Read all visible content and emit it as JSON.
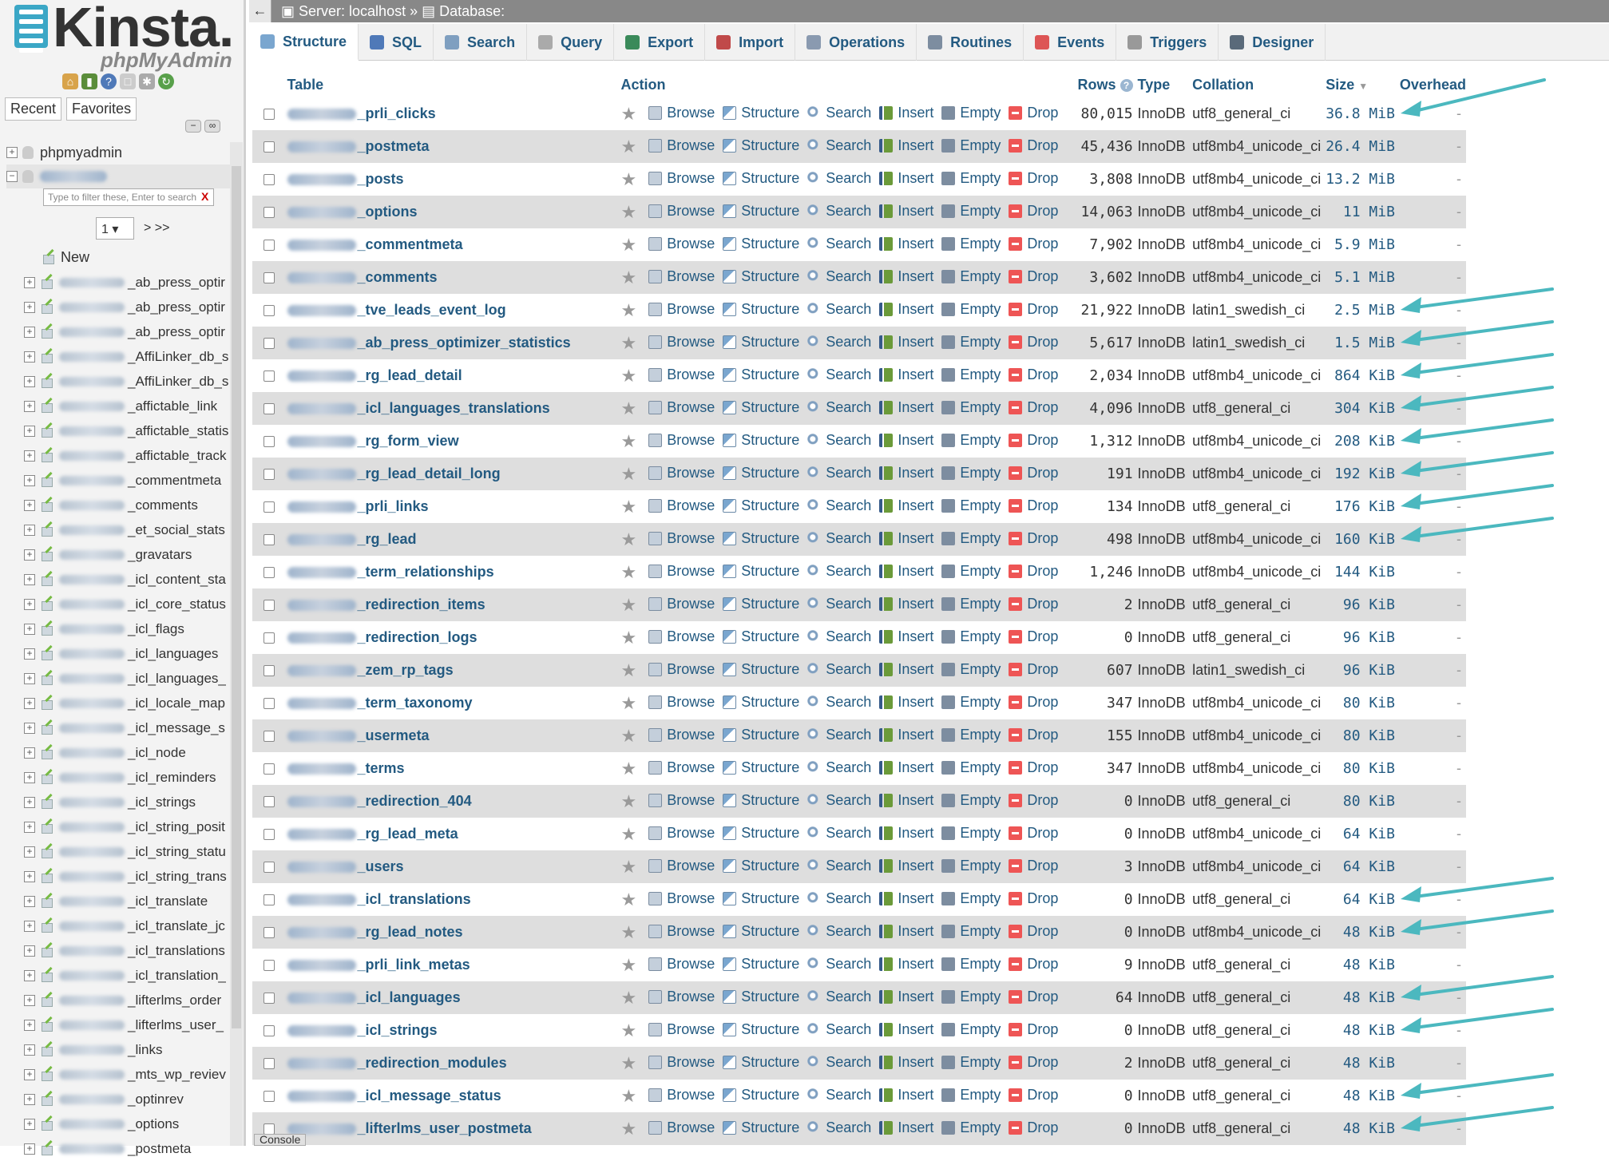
{
  "logo": {
    "brand": "Kinsta.",
    "product": "phpMyAdmin"
  },
  "nav": {
    "tab_recent": "Recent",
    "tab_favorites": "Favorites",
    "root_db": "phpmyadmin",
    "filter_placeholder": "Type to filter these, Enter to search",
    "filter_clear": "X",
    "page_value": "1",
    "page_next": "> >>",
    "new_label": "New",
    "items": [
      "_ab_press_optir",
      "_ab_press_optir",
      "_ab_press_optir",
      "_AffiLinker_db_s",
      "_AffiLinker_db_s",
      "_affictable_link",
      "_affictable_statis",
      "_affictable_track",
      "_commentmeta",
      "_comments",
      "_et_social_stats",
      "_gravatars",
      "_icl_content_sta",
      "_icl_core_status",
      "_icl_flags",
      "_icl_languages",
      "_icl_languages_",
      "_icl_locale_map",
      "_icl_message_s",
      "_icl_node",
      "_icl_reminders",
      "_icl_strings",
      "_icl_string_posit",
      "_icl_string_statu",
      "_icl_string_trans",
      "_icl_translate",
      "_icl_translate_jc",
      "_icl_translations",
      "_icl_translation_",
      "_lifterlms_order",
      "_lifterlms_user_",
      "_links",
      "_mts_wp_reviev",
      "_optinrev",
      "_options",
      "_postmeta"
    ]
  },
  "topbar": {
    "back": "←",
    "server": "Server: localhost »",
    "database": "Database:"
  },
  "tabs": [
    "Structure",
    "SQL",
    "Search",
    "Query",
    "Export",
    "Import",
    "Operations",
    "Routines",
    "Events",
    "Triggers",
    "Designer"
  ],
  "columns": {
    "table": "Table",
    "action": "Action",
    "rows": "Rows",
    "rows_help": "?",
    "type": "Type",
    "collation": "Collation",
    "size": "Size",
    "size_sort": "▼",
    "overhead": "Overhead"
  },
  "actions": {
    "browse": "Browse",
    "structure": "Structure",
    "search": "Search",
    "insert": "Insert",
    "empty": "Empty",
    "drop": "Drop"
  },
  "console": "Console",
  "rows": [
    {
      "name": "_prli_clicks",
      "rows": "80,015",
      "type": "InnoDB",
      "collation": "utf8_general_ci",
      "size": "36.8 MiB",
      "overhead": "-"
    },
    {
      "name": "_postmeta",
      "rows": "45,436",
      "type": "InnoDB",
      "collation": "utf8mb4_unicode_ci",
      "size": "26.4 MiB",
      "overhead": "-"
    },
    {
      "name": "_posts",
      "rows": "3,808",
      "type": "InnoDB",
      "collation": "utf8mb4_unicode_ci",
      "size": "13.2 MiB",
      "overhead": "-"
    },
    {
      "name": "_options",
      "rows": "14,063",
      "type": "InnoDB",
      "collation": "utf8mb4_unicode_ci",
      "size": "11 MiB",
      "overhead": "-"
    },
    {
      "name": "_commentmeta",
      "rows": "7,902",
      "type": "InnoDB",
      "collation": "utf8mb4_unicode_ci",
      "size": "5.9 MiB",
      "overhead": "-"
    },
    {
      "name": "_comments",
      "rows": "3,602",
      "type": "InnoDB",
      "collation": "utf8mb4_unicode_ci",
      "size": "5.1 MiB",
      "overhead": "-"
    },
    {
      "name": "_tve_leads_event_log",
      "rows": "21,922",
      "type": "InnoDB",
      "collation": "latin1_swedish_ci",
      "size": "2.5 MiB",
      "overhead": "-"
    },
    {
      "name": "_ab_press_optimizer_statistics",
      "rows": "5,617",
      "type": "InnoDB",
      "collation": "latin1_swedish_ci",
      "size": "1.5 MiB",
      "overhead": "-"
    },
    {
      "name": "_rg_lead_detail",
      "rows": "2,034",
      "type": "InnoDB",
      "collation": "utf8mb4_unicode_ci",
      "size": "864 KiB",
      "overhead": "-"
    },
    {
      "name": "_icl_languages_translations",
      "rows": "4,096",
      "type": "InnoDB",
      "collation": "utf8_general_ci",
      "size": "304 KiB",
      "overhead": "-"
    },
    {
      "name": "_rg_form_view",
      "rows": "1,312",
      "type": "InnoDB",
      "collation": "utf8mb4_unicode_ci",
      "size": "208 KiB",
      "overhead": "-"
    },
    {
      "name": "_rg_lead_detail_long",
      "rows": "191",
      "type": "InnoDB",
      "collation": "utf8mb4_unicode_ci",
      "size": "192 KiB",
      "overhead": "-"
    },
    {
      "name": "_prli_links",
      "rows": "134",
      "type": "InnoDB",
      "collation": "utf8_general_ci",
      "size": "176 KiB",
      "overhead": "-"
    },
    {
      "name": "_rg_lead",
      "rows": "498",
      "type": "InnoDB",
      "collation": "utf8mb4_unicode_ci",
      "size": "160 KiB",
      "overhead": "-"
    },
    {
      "name": "_term_relationships",
      "rows": "1,246",
      "type": "InnoDB",
      "collation": "utf8mb4_unicode_ci",
      "size": "144 KiB",
      "overhead": "-"
    },
    {
      "name": "_redirection_items",
      "rows": "2",
      "type": "InnoDB",
      "collation": "utf8_general_ci",
      "size": "96 KiB",
      "overhead": "-"
    },
    {
      "name": "_redirection_logs",
      "rows": "0",
      "type": "InnoDB",
      "collation": "utf8_general_ci",
      "size": "96 KiB",
      "overhead": "-"
    },
    {
      "name": "_zem_rp_tags",
      "rows": "607",
      "type": "InnoDB",
      "collation": "latin1_swedish_ci",
      "size": "96 KiB",
      "overhead": "-"
    },
    {
      "name": "_term_taxonomy",
      "rows": "347",
      "type": "InnoDB",
      "collation": "utf8mb4_unicode_ci",
      "size": "80 KiB",
      "overhead": "-"
    },
    {
      "name": "_usermeta",
      "rows": "155",
      "type": "InnoDB",
      "collation": "utf8mb4_unicode_ci",
      "size": "80 KiB",
      "overhead": "-"
    },
    {
      "name": "_terms",
      "rows": "347",
      "type": "InnoDB",
      "collation": "utf8mb4_unicode_ci",
      "size": "80 KiB",
      "overhead": "-"
    },
    {
      "name": "_redirection_404",
      "rows": "0",
      "type": "InnoDB",
      "collation": "utf8_general_ci",
      "size": "80 KiB",
      "overhead": "-"
    },
    {
      "name": "_rg_lead_meta",
      "rows": "0",
      "type": "InnoDB",
      "collation": "utf8mb4_unicode_ci",
      "size": "64 KiB",
      "overhead": "-"
    },
    {
      "name": "_users",
      "rows": "3",
      "type": "InnoDB",
      "collation": "utf8mb4_unicode_ci",
      "size": "64 KiB",
      "overhead": "-"
    },
    {
      "name": "_icl_translations",
      "rows": "0",
      "type": "InnoDB",
      "collation": "utf8_general_ci",
      "size": "64 KiB",
      "overhead": "-"
    },
    {
      "name": "_rg_lead_notes",
      "rows": "0",
      "type": "InnoDB",
      "collation": "utf8mb4_unicode_ci",
      "size": "48 KiB",
      "overhead": "-"
    },
    {
      "name": "_prli_link_metas",
      "rows": "9",
      "type": "InnoDB",
      "collation": "utf8_general_ci",
      "size": "48 KiB",
      "overhead": "-"
    },
    {
      "name": "_icl_languages",
      "rows": "64",
      "type": "InnoDB",
      "collation": "utf8_general_ci",
      "size": "48 KiB",
      "overhead": "-"
    },
    {
      "name": "_icl_strings",
      "rows": "0",
      "type": "InnoDB",
      "collation": "utf8_general_ci",
      "size": "48 KiB",
      "overhead": "-"
    },
    {
      "name": "_redirection_modules",
      "rows": "2",
      "type": "InnoDB",
      "collation": "utf8_general_ci",
      "size": "48 KiB",
      "overhead": "-"
    },
    {
      "name": "_icl_message_status",
      "rows": "0",
      "type": "InnoDB",
      "collation": "utf8_general_ci",
      "size": "48 KiB",
      "overhead": "-"
    },
    {
      "name": "_lifterlms_user_postmeta",
      "rows": "0",
      "type": "InnoDB",
      "collation": "utf8_general_ci",
      "size": "48 KiB",
      "overhead": "-"
    }
  ],
  "arrow_rows": [
    0,
    6,
    7,
    8,
    9,
    10,
    11,
    12,
    13,
    24,
    25,
    27,
    28,
    30,
    31
  ],
  "colors": {
    "link": "#235a81",
    "arrow": "#4bb8bf",
    "row_alt": "#dedede"
  }
}
